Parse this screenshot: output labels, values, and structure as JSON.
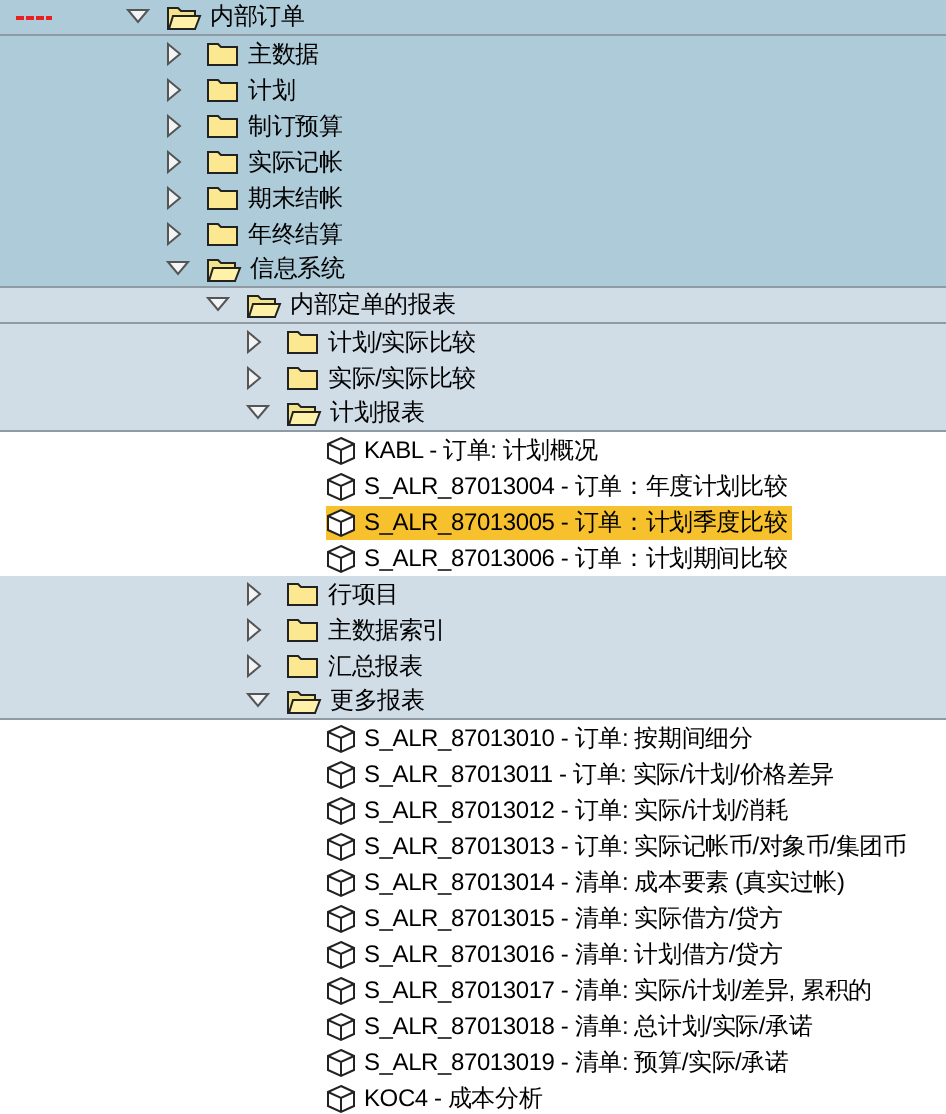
{
  "tree": [
    {
      "kind": "folder",
      "label": "内部订单",
      "expanded": true,
      "children": [
        {
          "kind": "folder",
          "label": "主数据",
          "expanded": false
        },
        {
          "kind": "folder",
          "label": "计划",
          "expanded": false
        },
        {
          "kind": "folder",
          "label": "制订预算",
          "expanded": false
        },
        {
          "kind": "folder",
          "label": "实际记帐",
          "expanded": false
        },
        {
          "kind": "folder",
          "label": "期末结帐",
          "expanded": false
        },
        {
          "kind": "folder",
          "label": "年终结算",
          "expanded": false
        },
        {
          "kind": "folder",
          "label": "信息系统",
          "expanded": true,
          "children": [
            {
              "kind": "folder",
              "label": "内部定单的报表",
              "expanded": true,
              "children": [
                {
                  "kind": "folder",
                  "label": "计划/实际比较",
                  "expanded": false
                },
                {
                  "kind": "folder",
                  "label": "实际/实际比较",
                  "expanded": false
                },
                {
                  "kind": "folder",
                  "label": "计划报表",
                  "expanded": true,
                  "children": [
                    {
                      "kind": "leaf",
                      "label": "KABL - 订单: 计划概况",
                      "selected": false
                    },
                    {
                      "kind": "leaf",
                      "label": "S_ALR_87013004 - 订单：年度计划比较",
                      "selected": false
                    },
                    {
                      "kind": "leaf",
                      "label": "S_ALR_87013005 - 订单：计划季度比较",
                      "selected": true
                    },
                    {
                      "kind": "leaf",
                      "label": "S_ALR_87013006 - 订单：计划期间比较",
                      "selected": false
                    }
                  ]
                },
                {
                  "kind": "folder",
                  "label": "行项目",
                  "expanded": false
                },
                {
                  "kind": "folder",
                  "label": "主数据索引",
                  "expanded": false
                },
                {
                  "kind": "folder",
                  "label": "汇总报表",
                  "expanded": false
                },
                {
                  "kind": "folder",
                  "label": "更多报表",
                  "expanded": true,
                  "children": [
                    {
                      "kind": "leaf",
                      "label": "S_ALR_87013010 - 订单: 按期间细分",
                      "selected": false
                    },
                    {
                      "kind": "leaf",
                      "label": "S_ALR_87013011 - 订单: 实际/计划/价格差异",
                      "selected": false
                    },
                    {
                      "kind": "leaf",
                      "label": "S_ALR_87013012 - 订单: 实际/计划/消耗",
                      "selected": false
                    },
                    {
                      "kind": "leaf",
                      "label": "S_ALR_87013013 - 订单: 实际记帐币/对象币/集团币",
                      "selected": false
                    },
                    {
                      "kind": "leaf",
                      "label": "S_ALR_87013014 - 清单: 成本要素 (真实过帐)",
                      "selected": false
                    },
                    {
                      "kind": "leaf",
                      "label": "S_ALR_87013015 - 清单: 实际借方/贷方",
                      "selected": false
                    },
                    {
                      "kind": "leaf",
                      "label": "S_ALR_87013016 - 清单: 计划借方/贷方",
                      "selected": false
                    },
                    {
                      "kind": "leaf",
                      "label": "S_ALR_87013017 - 清单: 实际/计划/差异, 累积的",
                      "selected": false
                    },
                    {
                      "kind": "leaf",
                      "label": "S_ALR_87013018 - 清单: 总计划/实际/承诺",
                      "selected": false
                    },
                    {
                      "kind": "leaf",
                      "label": "S_ALR_87013019 - 清单: 预算/实际/承诺",
                      "selected": false
                    },
                    {
                      "kind": "leaf",
                      "label": "KOC4 - 成本分析",
                      "selected": false
                    }
                  ]
                }
              ]
            }
          ]
        }
      ]
    }
  ]
}
